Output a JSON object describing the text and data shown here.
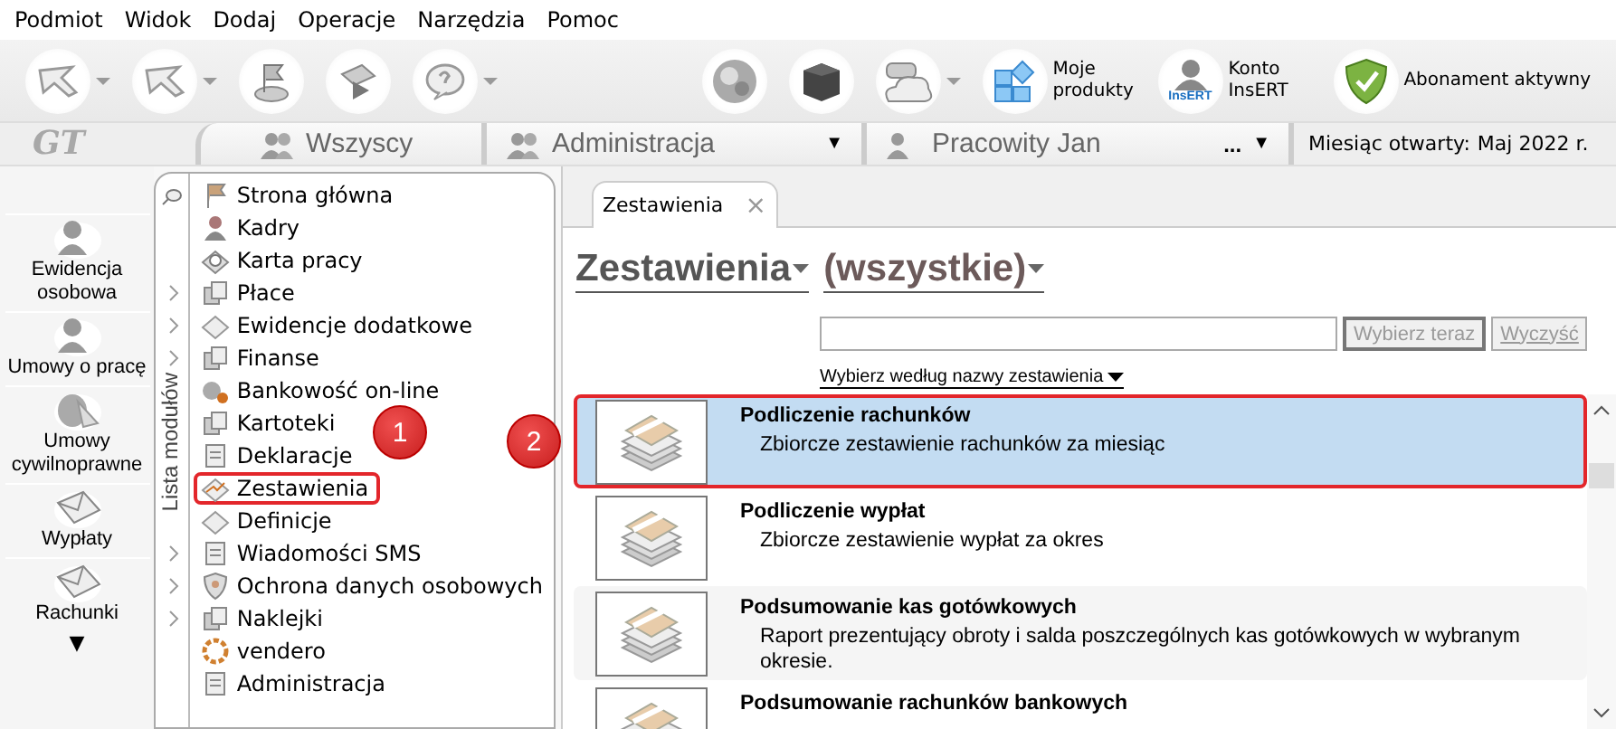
{
  "menu": [
    "Podmiot",
    "Widok",
    "Dodaj",
    "Operacje",
    "Narzędzia",
    "Pomoc"
  ],
  "toolbar": {
    "left": [
      {
        "has_menu": true
      },
      {
        "has_menu": true
      },
      {
        "has_menu": false
      },
      {
        "has_menu": false
      },
      {
        "has_menu": true
      }
    ],
    "right": [
      {
        "has_menu": false
      },
      {
        "has_menu": false
      },
      {
        "has_menu": true
      },
      {
        "has_menu": false,
        "label": "Moje produkty"
      },
      {
        "has_menu": false,
        "label": "Konto InsERT",
        "badge": "InsERT"
      },
      {
        "has_menu": false,
        "label": "Abonament aktywny"
      }
    ]
  },
  "logo": "GT",
  "context_tabs": [
    {
      "label": "Wszyscy"
    },
    {
      "label": "Administracja",
      "arrow": "▼"
    },
    {
      "label": "Pracowity Jan",
      "more": "...",
      "arrow": "▼"
    }
  ],
  "open_month": {
    "label": "Miesiąc otwarty:",
    "value": "Maj 2022 r."
  },
  "sidebar": {
    "items": [
      {
        "label": "Ewidencja osobowa"
      },
      {
        "label": "Umowy o pracę"
      },
      {
        "label": "Umowy cywilnoprawne"
      },
      {
        "label": "Wypłaty"
      },
      {
        "label": "Rachunki"
      }
    ],
    "more": "▼"
  },
  "modules": {
    "title": "Lista modułów",
    "items": [
      {
        "label": "Strona główna",
        "has_submenu": false,
        "annotated": false
      },
      {
        "label": "Kadry",
        "has_submenu": false,
        "annotated": false
      },
      {
        "label": "Karta pracy",
        "has_submenu": false,
        "annotated": false
      },
      {
        "label": "Płace",
        "has_submenu": true,
        "annotated": false
      },
      {
        "label": "Ewidencje dodatkowe",
        "has_submenu": true,
        "annotated": false
      },
      {
        "label": "Finanse",
        "has_submenu": true,
        "annotated": false
      },
      {
        "label": "Bankowość on-line",
        "has_submenu": false,
        "annotated": false
      },
      {
        "label": "Kartoteki",
        "has_submenu": false,
        "annotated": false
      },
      {
        "label": "Deklaracje",
        "has_submenu": false,
        "annotated": false
      },
      {
        "label": "Zestawienia",
        "has_submenu": false,
        "annotated": true
      },
      {
        "label": "Definicje",
        "has_submenu": false,
        "annotated": false
      },
      {
        "label": "Wiadomości SMS",
        "has_submenu": true,
        "annotated": false
      },
      {
        "label": "Ochrona danych osobowych",
        "has_submenu": true,
        "annotated": false
      },
      {
        "label": "Naklejki",
        "has_submenu": true,
        "annotated": false
      },
      {
        "label": "vendero",
        "has_submenu": false,
        "annotated": false
      },
      {
        "label": "Administracja",
        "has_submenu": false,
        "annotated": false
      }
    ]
  },
  "document_tab": {
    "label": "Zestawienia",
    "close": "×"
  },
  "heading": {
    "category": "Zestawienia",
    "filter": "(wszystkie)"
  },
  "search": {
    "button": "Wybierz teraz",
    "clear": "Wyczyść",
    "mode": "Wybierz według nazwy zestawienia"
  },
  "reports": [
    {
      "title": "Podliczenie rachunków",
      "description": "Zbiorcze zestawienie rachunków za miesiąc",
      "selected": true,
      "annotated": true
    },
    {
      "title": "Podliczenie wypłat",
      "description": "Zbiorcze zestawienie wypłat za okres",
      "selected": false,
      "annotated": false
    },
    {
      "title": "Podsumowanie kas gotówkowych",
      "description": "Raport prezentujący obroty i salda poszczególnych kas gotówkowych w wybranym okresie.",
      "selected": false,
      "annotated": false
    },
    {
      "title": "Podsumowanie rachunków bankowych",
      "selected": false,
      "annotated": false
    }
  ],
  "step_badges": [
    "1",
    "2"
  ]
}
